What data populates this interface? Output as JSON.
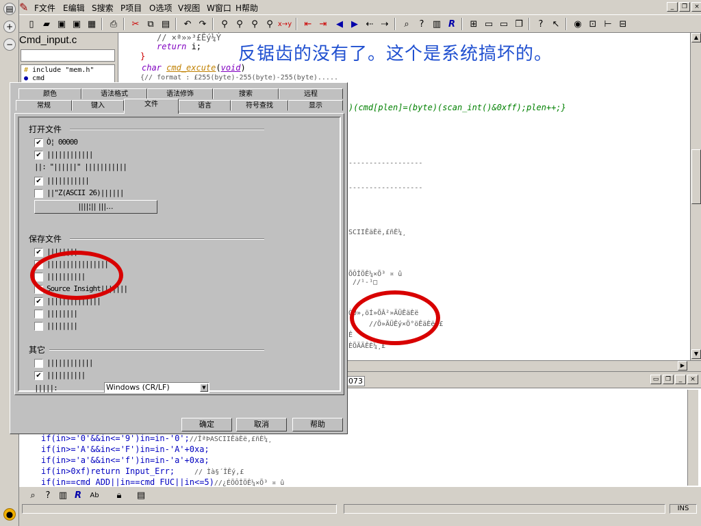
{
  "menu": {
    "items": [
      "F文件",
      "E编辑",
      "S搜索",
      "P项目",
      "O选项",
      "V视图",
      "W窗口",
      "H帮助"
    ]
  },
  "sidebar": {
    "file_title": "Cmd_input.c",
    "symbols": [
      "include \"mem.h\"",
      "cmd"
    ]
  },
  "overlay_text": "反锯齿的没有了。这个是系统搞坏的。",
  "editor": {
    "lines": {
      "l1": "// ×ª»»³£Êý¼Ý",
      "l2_kw": "return",
      "l2_rest": " i;",
      "l3": "}",
      "l4_kw": "char ",
      "l4_fn": "cmd_excute",
      "l4_args": "(",
      "l4_void": "void",
      "l4_end": ")",
      "l5": "{// format : £255(byte)-255(byte)-255(byte)....."
    },
    "right_fragments": {
      "f1": ")(cmd[plen]=(byte)(scan_int()&0xff);plen++;}",
      "f2": "------------------",
      "f3": "------------------",
      "f4": "SCIIÊäÈë,£ñÈ¼¸",
      "f5": "ÕÔÎÖÊ¼×Õ³ ¤ û",
      "f6": "//¹-¹□",
      "f7": "ÒÒ»,öÍ»ÕÂ²»ÄÜÊäÈë",
      "f8": "//Õ»ÄÜÊý×Ö°öÊäÈë¸£",
      "f9": "Ê",
      "f10": "ÈÕÄÄÊÈ¼¸£"
    }
  },
  "dialog": {
    "tabs_row1": [
      "颜色",
      "语法格式",
      "语法修饰",
      "搜索",
      "远程"
    ],
    "tabs_row2": [
      "常规",
      "键入",
      "文件",
      "语言",
      "符号查找",
      "显示"
    ],
    "groups": {
      "open": "打开文件",
      "save": "保存文件",
      "other": "其它"
    },
    "open_items": [
      {
        "checked": true,
        "label": "Ò¦ 00000"
      },
      {
        "checked": true,
        "label": "||||||||||||"
      },
      {
        "checked": null,
        "label": "||: \"||||||\" |||||||||||"
      },
      {
        "checked": true,
        "label": "|||||||||||"
      },
      {
        "checked": false,
        "label": "||\"Z(ASCII 26)||||||"
      }
    ],
    "open_button": "||||¦|| |||...",
    "save_items": [
      {
        "checked": true,
        "label": "||||||||"
      },
      {
        "checked": false,
        "label": "||||||||||||||||"
      },
      {
        "checked": false,
        "label": "||||||||||"
      },
      {
        "checked": false,
        "label": "Source Insight|||||||"
      },
      {
        "checked": true,
        "label": "||||||||||||||"
      },
      {
        "checked": false,
        "label": "||||||||"
      },
      {
        "checked": false,
        "label": "||||||||"
      }
    ],
    "other_items": [
      {
        "checked": false,
        "label": "||||||||||||"
      },
      {
        "checked": true,
        "label": "||||||||||"
      }
    ],
    "line_ending_label": "|||||:",
    "line_ending_value": "Windows (CR/LF)",
    "buttons": {
      "ok": "确定",
      "cancel": "取消",
      "help": "帮助"
    }
  },
  "bottom_panel": {
    "tab_label": "073",
    "lines": [
      {
        "pre": "if(in>='0'&&in<='9')in=in-'0';",
        "post": "//ÎªÞASCIIÊäÈë,£ñÈ¼¸"
      },
      {
        "pre": "if(in>='A'&&in<='F')in=in-'A'+0xa;",
        "post": ""
      },
      {
        "pre": "if(in>='a'&&in<='f')in=in-'a'+0xa;",
        "post": ""
      },
      {
        "pre": "if(in>0xf)return Input_Err;",
        "post": "// Ìà§´ÎÊý,£"
      },
      {
        "pre": "if(in==cmd_ADD||in==cmd_FUC||in<=5)",
        "post": "//¿ÉÕÔÎÖÊ¼×Õ³ ¤ û"
      }
    ]
  },
  "status": {
    "ins": "INS"
  },
  "colors": {
    "annotation_red": "#d80000",
    "overlay_blue": "#2050d0"
  }
}
